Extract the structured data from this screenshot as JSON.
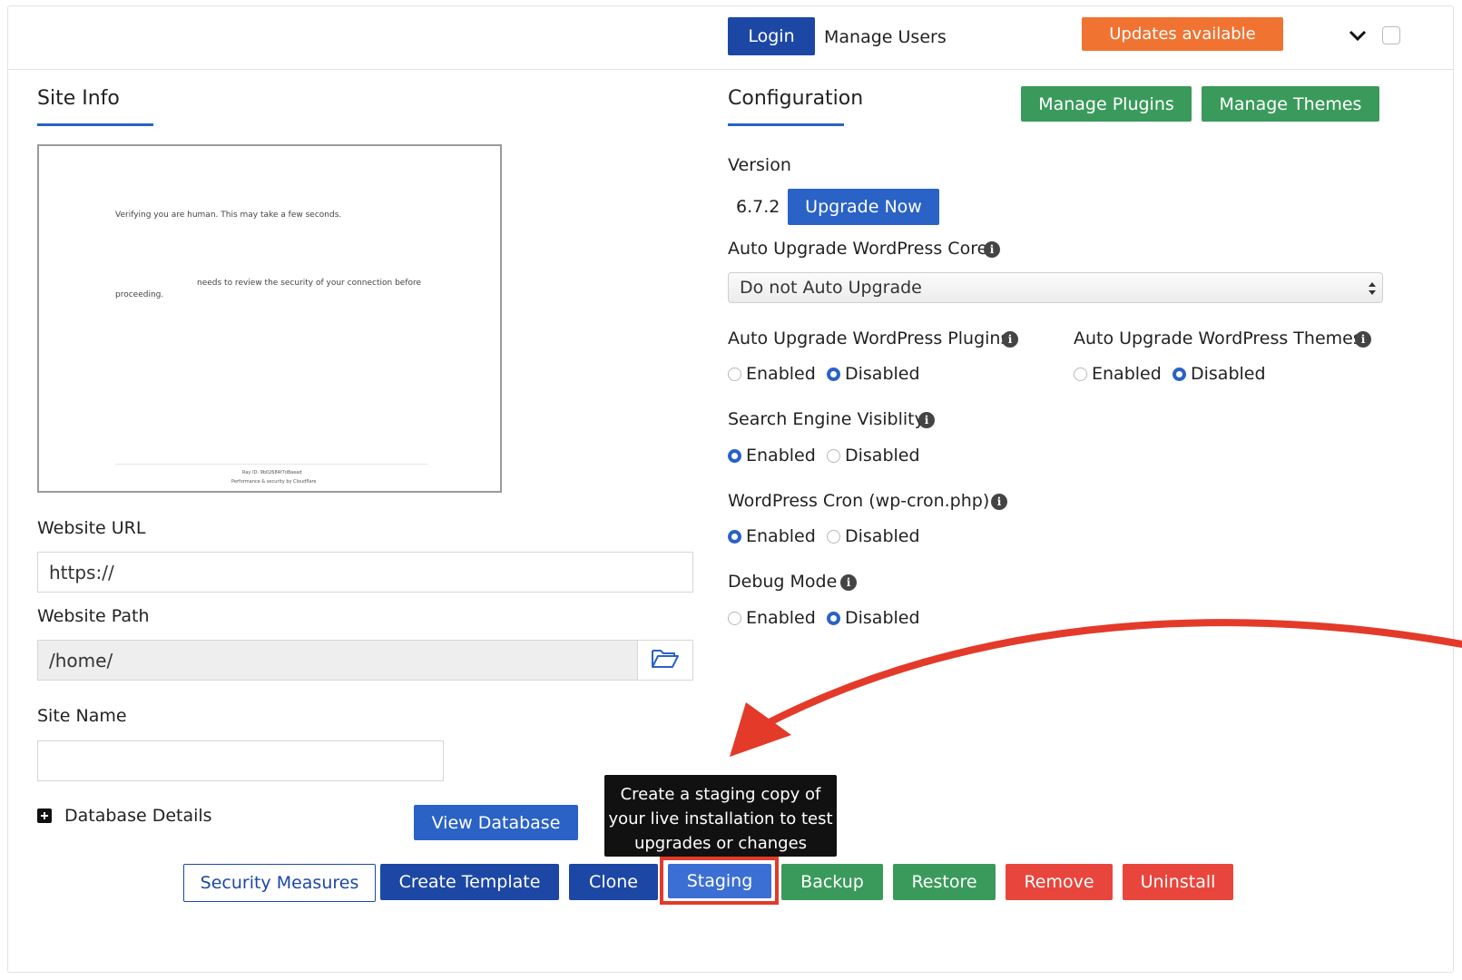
{
  "header": {
    "login_label": "Login",
    "manage_users_label": "Manage Users",
    "updates_label": "Updates available"
  },
  "site_info": {
    "title": "Site Info",
    "preview": {
      "line1": "Verifying you are human. This may take a few seconds.",
      "line2": "needs to review the security of your connection before",
      "line3": "proceeding.",
      "footer1": "Ray ID: 9b02684f7d8aead",
      "footer2": "Performance & security by Cloudflare"
    },
    "website_url_label": "Website URL",
    "website_url_value": "https://",
    "website_path_label": "Website Path",
    "website_path_value": "/home/",
    "site_name_label": "Site Name",
    "site_name_value": "",
    "database_details_label": "Database Details",
    "view_database_label": "View Database"
  },
  "configuration": {
    "title": "Configuration",
    "manage_plugins_label": "Manage Plugins",
    "manage_themes_label": "Manage Themes",
    "version_label": "Version",
    "version_value": "6.7.2",
    "upgrade_now_label": "Upgrade Now",
    "auto_core_label": "Auto Upgrade WordPress Core",
    "auto_core_selected": "Do not Auto Upgrade",
    "auto_plugins_label": "Auto Upgrade WordPress Plugins",
    "auto_themes_label": "Auto Upgrade WordPress Themes",
    "search_engine_label": "Search Engine Visiblity",
    "cron_label": "WordPress Cron (wp-cron.php)",
    "debug_label": "Debug Mode",
    "enabled": "Enabled",
    "disabled": "Disabled",
    "info_glyph": "i",
    "states": {
      "auto_plugins": "Disabled",
      "auto_themes": "Disabled",
      "search_engine": "Enabled",
      "cron": "Enabled",
      "debug": "Disabled"
    }
  },
  "tooltip": {
    "line1": "Create a staging copy of",
    "line2": "your live installation to test",
    "line3": "upgrades or changes"
  },
  "actions": {
    "security": "Security Measures",
    "template": "Create Template",
    "clone": "Clone",
    "staging": "Staging",
    "backup": "Backup",
    "restore": "Restore",
    "remove": "Remove",
    "uninstall": "Uninstall"
  },
  "colors": {
    "blue": "#2a62c6",
    "navy": "#1c47a5",
    "green": "#3a9a5b",
    "red": "#e8463c",
    "orange": "#f07332",
    "annotation": "#e33a2a"
  }
}
